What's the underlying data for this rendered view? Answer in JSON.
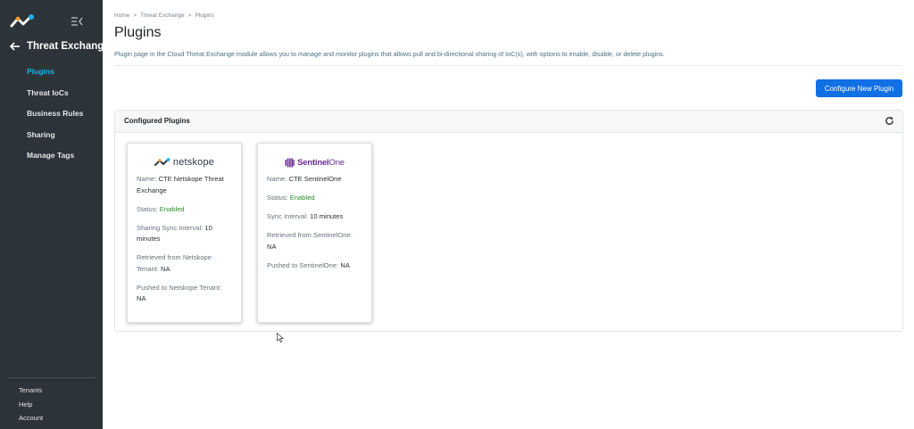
{
  "sidebar": {
    "logo_icon": "netskope-logo-icon",
    "collapse_icon": "collapse-menu-icon",
    "back_label": "Threat Exchange",
    "nav": [
      {
        "label": "Plugins",
        "active": true
      },
      {
        "label": "Threat IoCs",
        "active": false
      },
      {
        "label": "Business Rules",
        "active": false
      },
      {
        "label": "Sharing",
        "active": false
      },
      {
        "label": "Manage Tags",
        "active": false
      }
    ],
    "footer": [
      {
        "label": "Tenants"
      },
      {
        "label": "Help"
      },
      {
        "label": "Account"
      }
    ],
    "colors": {
      "background": "#2d3439",
      "active": "#1fb0e6"
    }
  },
  "breadcrumb": {
    "home": "Home",
    "section": "Threat Exchange",
    "current": "Plugins",
    "separator": ">"
  },
  "page": {
    "title": "Plugins",
    "description": "Plugin page in the Cloud Threat Exchange module allows you to manage and monitor plugins that allows pull and bi-directional sharing of IoC(s), with options to enable, disable, or delete plugins."
  },
  "toolbar": {
    "configure_label": "Configure New Plugin",
    "accent": "#1170e4"
  },
  "configured": {
    "title": "Configured Plugins",
    "refresh_icon": "refresh-icon",
    "plugins": [
      {
        "logo_text": "netskope",
        "name_label": "Name:",
        "name": "CTE Netskope Threat Exchange",
        "status_label": "Status:",
        "status": "Enabled",
        "sync_label": "Sharing Sync Interval:",
        "sync": "10 minutes",
        "retrieved_label": "Retrieved from Netskope Tenant:",
        "retrieved": "NA",
        "pushed_label": "Pushed to Netskope Tenant:",
        "pushed": "NA"
      },
      {
        "logo_bold": "Sentinel",
        "logo_thin": "One",
        "name_label": "Name:",
        "name": "CTE SentinelOne",
        "status_label": "Status:",
        "status": "Enabled",
        "sync_label": "Sync Interval:",
        "sync": "10 minutes",
        "retrieved_label": "Retrieved from SentinelOne:",
        "retrieved": "NA",
        "pushed_label": "Pushed to SentinelOne:",
        "pushed": "NA"
      }
    ]
  }
}
